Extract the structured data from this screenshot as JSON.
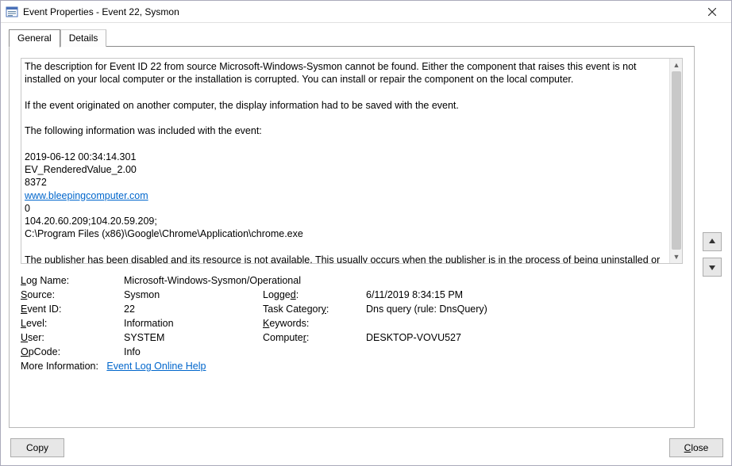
{
  "window": {
    "title": "Event Properties - Event 22, Sysmon"
  },
  "tabs": {
    "general": "General",
    "details": "Details"
  },
  "description": {
    "para1": "The description for Event ID 22 from source Microsoft-Windows-Sysmon cannot be found. Either the component that raises this event is not installed on your local computer or the installation is corrupted. You can install or repair the component on the local computer.",
    "para2": "If the event originated on another computer, the display information had to be saved with the event.",
    "para3": "The following information was included with the event:",
    "lines": {
      "ts": "2019-06-12 00:34:14.301",
      "rv": "EV_RenderedValue_2.00",
      "pid": "8372",
      "link": "www.bleepingcomputer.com",
      "zero": "0",
      "ips": "104.20.60.209;104.20.59.209;",
      "path": "C:\\Program Files (x86)\\Google\\Chrome\\Application\\chrome.exe"
    },
    "para4": "The publisher has been disabled and its resource is not available. This usually occurs when the publisher is in the process of being uninstalled or upgraded"
  },
  "props": {
    "log_name_label": "Log Name:",
    "log_name_value": "Microsoft-Windows-Sysmon/Operational",
    "source_label": "Source:",
    "source_value": "Sysmon",
    "logged_label": "Logged:",
    "logged_value": "6/11/2019 8:34:15 PM",
    "event_id_label": "Event ID:",
    "event_id_value": "22",
    "task_category_label": "Task Category:",
    "task_category_value": "Dns query (rule: DnsQuery)",
    "level_label": "Level:",
    "level_value": "Information",
    "keywords_label": "Keywords:",
    "keywords_value": "",
    "user_label": "User:",
    "user_value": "SYSTEM",
    "computer_label": "Computer:",
    "computer_value": "DESKTOP-VOVU527",
    "opcode_label": "OpCode:",
    "opcode_value": "Info",
    "more_info_label": "More Information:",
    "more_info_link": "Event Log Online Help"
  },
  "buttons": {
    "copy": "Copy",
    "close": "Close"
  }
}
